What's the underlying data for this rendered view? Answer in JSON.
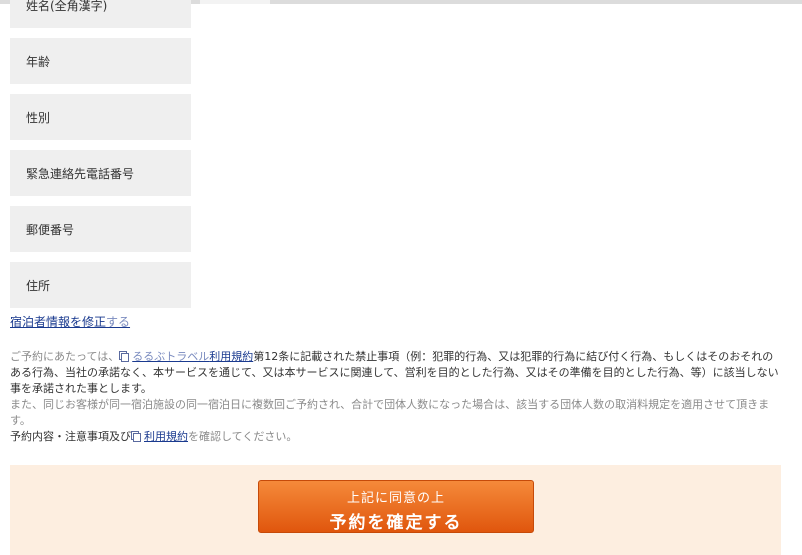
{
  "form": {
    "fields": [
      {
        "label": "姓名(全角漢字)",
        "value": ""
      },
      {
        "label": "年齢",
        "value": ""
      },
      {
        "label": "性別",
        "value": ""
      },
      {
        "label": "緊急連絡先電話番号",
        "value": ""
      },
      {
        "label": "郵便番号",
        "value": ""
      },
      {
        "label": "住所",
        "value": ""
      }
    ]
  },
  "edit_link": {
    "main": "宿泊者情報を修正",
    "suffix": "する"
  },
  "terms": {
    "p1_prefix": "ご予約にあたっては、",
    "link1_light": "るるぶトラベル",
    "link1_dark": "利用規約",
    "p1_body": "第12条に記載された禁止事項（例：犯罪的行為、又は犯罪的行為に結び付く行為、もしくはそのおそれのある行為、当社の承諾なく、本サービスを通じて、又は本サービスに関連して、営利を目的とした行為、又はその準備を目的とした行為、等）に該当しない事を承諾された事とします。",
    "p2": "また、同じお客様が同一宿泊施設の同一宿泊日に複数回ご予約され、合計で団体人数になった場合は、該当する団体人数の取消料規定を適用させて頂きます。",
    "p3_prefix": "予約内容・注意事項及び",
    "link2": "利用規約",
    "p3_suffix": "を確認してください。"
  },
  "confirm": {
    "line1": "上記に同意の上",
    "line2": "予約を確定する"
  },
  "colors": {
    "accent": "#e8661c",
    "panel": "#fdeee0",
    "link": "#1a3a8f",
    "label_bg": "#efefef"
  }
}
